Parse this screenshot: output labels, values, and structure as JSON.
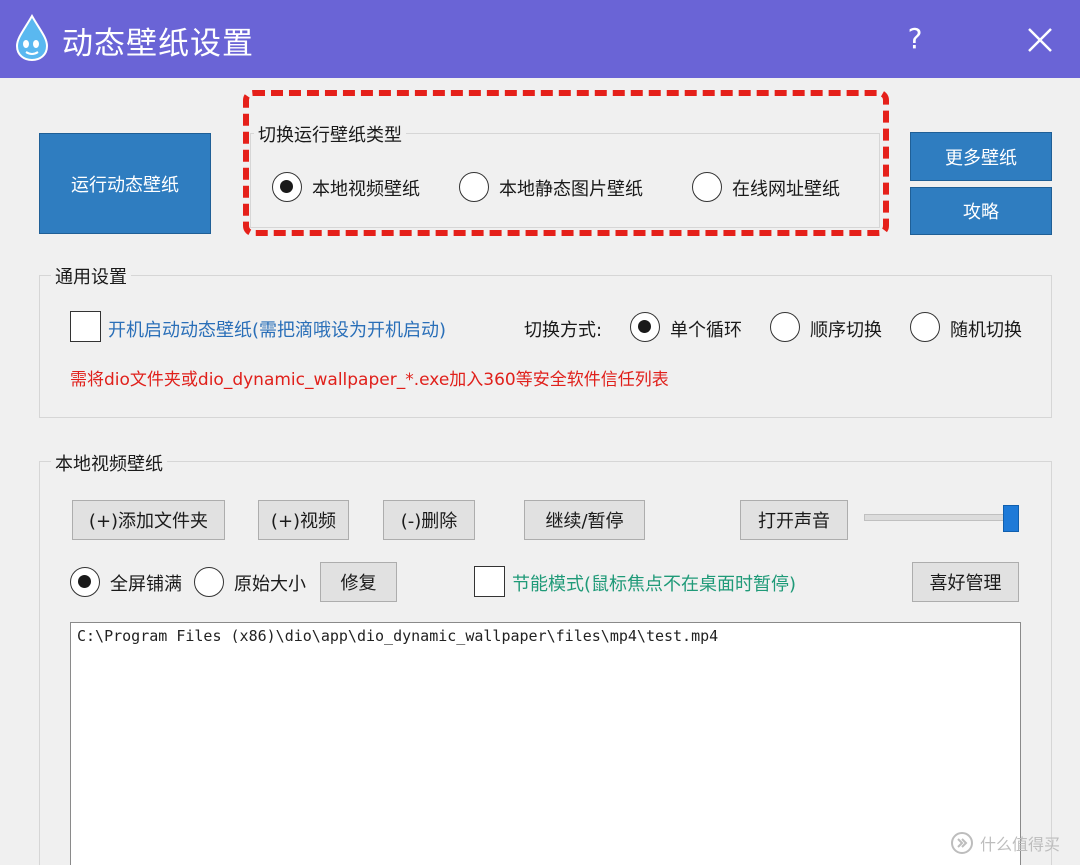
{
  "window": {
    "title": "动态壁纸设置",
    "help_label": "?"
  },
  "buttons": {
    "run": "运行动态壁纸",
    "more": "更多壁纸",
    "guide": "攻略"
  },
  "switch_type": {
    "title": "切换运行壁纸类型",
    "options": [
      {
        "label": "本地视频壁纸",
        "checked": true
      },
      {
        "label": "本地静态图片壁纸",
        "checked": false
      },
      {
        "label": "在线网址壁纸",
        "checked": false
      }
    ]
  },
  "general": {
    "title": "通用设置",
    "autostart_label": "开机启动动态壁纸(需把滴哦设为开机启动)",
    "autostart_checked": false,
    "switch_mode_label": "切换方式:",
    "switch_modes": [
      {
        "label": "单个循环",
        "checked": true
      },
      {
        "label": "顺序切换",
        "checked": false
      },
      {
        "label": "随机切换",
        "checked": false
      }
    ],
    "warning": "需将dio文件夹或dio_dynamic_wallpaper_*.exe加入360等安全软件信任列表"
  },
  "local_video": {
    "title": "本地视频壁纸",
    "add_folder": "(+)添加文件夹",
    "add_video": "(+)视频",
    "delete": "(-)删除",
    "resume_pause": "继续/暂停",
    "open_sound": "打开声音",
    "volume_fraction": 1.0,
    "fill_modes": [
      {
        "label": "全屏铺满",
        "checked": true
      },
      {
        "label": "原始大小",
        "checked": false
      }
    ],
    "repair": "修复",
    "energy_label": "节能模式(鼠标焦点不在桌面时暂停)",
    "energy_checked": false,
    "favorites": "喜好管理",
    "files": [
      "C:\\Program Files (x86)\\dio\\app\\dio_dynamic_wallpaper\\files\\mp4\\test.mp4"
    ]
  },
  "watermark": "什么值得买",
  "colors": {
    "titlebar": "#6a64d6",
    "primary_button": "#2f7dc0",
    "link_text": "#2a6fb8",
    "warning_text": "#e0201b",
    "energy_text": "#1f9a78",
    "highlight_dash": "#e5201a"
  }
}
